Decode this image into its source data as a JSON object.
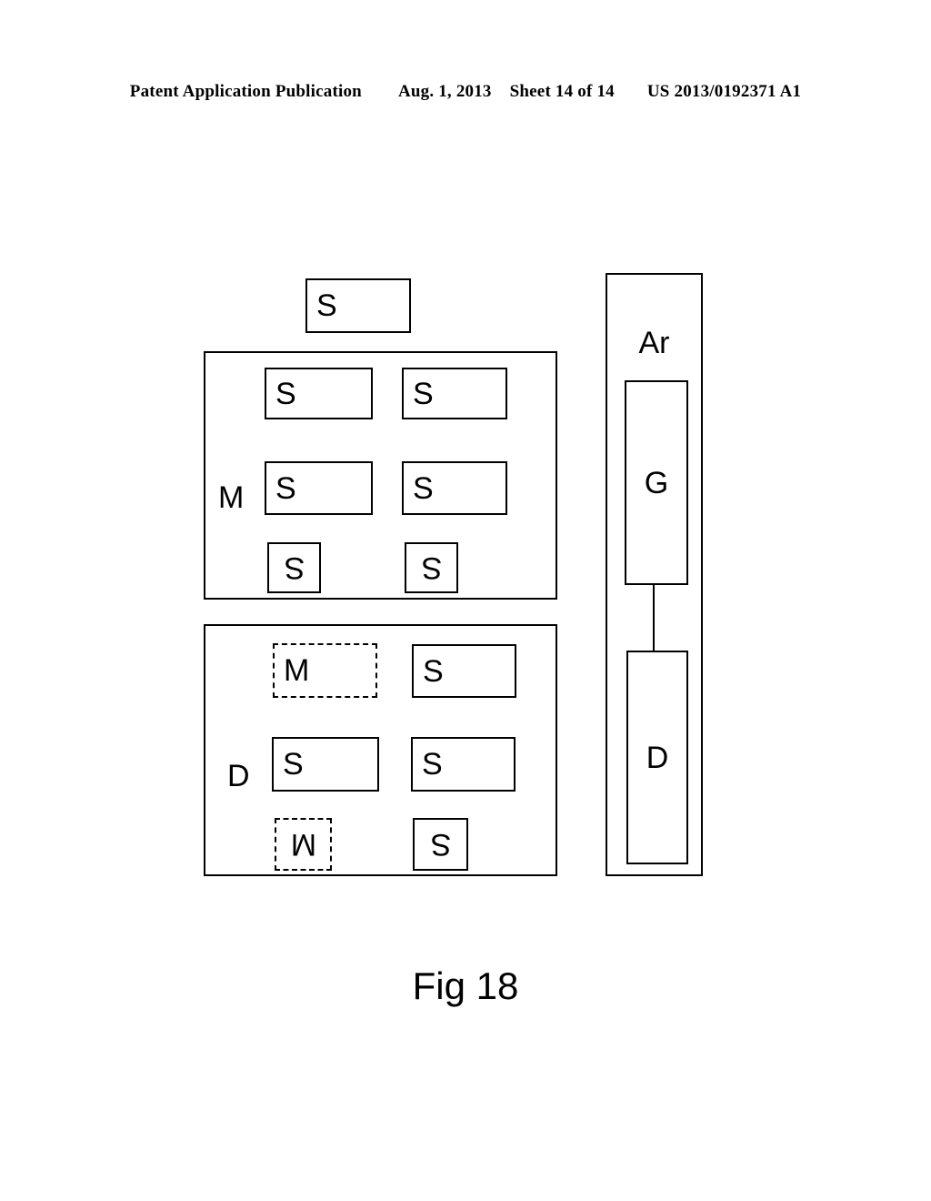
{
  "header": {
    "publication": "Patent Application Publication",
    "date": "Aug. 1, 2013",
    "sheet": "Sheet 14 of 14",
    "patent_number": "US 2013/0192371 A1"
  },
  "figure": {
    "caption": "Fig 18",
    "top_box": {
      "label": "S"
    },
    "m_group": {
      "letter": "M",
      "boxes": [
        {
          "label": "S",
          "style": "solid",
          "rotated": false
        },
        {
          "label": "S",
          "style": "solid",
          "rotated": false
        },
        {
          "label": "S",
          "style": "solid",
          "rotated": false
        },
        {
          "label": "S",
          "style": "solid",
          "rotated": false
        },
        {
          "label": "S",
          "style": "solid",
          "rotated": true
        },
        {
          "label": "S",
          "style": "solid",
          "rotated": true
        }
      ]
    },
    "d_group": {
      "letter": "D",
      "boxes": [
        {
          "label": "M",
          "style": "dashed",
          "rotated": false
        },
        {
          "label": "S",
          "style": "solid",
          "rotated": false
        },
        {
          "label": "S",
          "style": "solid",
          "rotated": false
        },
        {
          "label": "S",
          "style": "solid",
          "rotated": false
        },
        {
          "label": "M",
          "style": "dashed",
          "rotated": true
        },
        {
          "label": "S",
          "style": "solid",
          "rotated": true
        }
      ]
    },
    "ar_group": {
      "label": "Ar",
      "boxes": [
        {
          "label": "G"
        },
        {
          "label": "D"
        }
      ]
    }
  },
  "colors": {
    "ink": "#000000",
    "paper": "#ffffff"
  }
}
